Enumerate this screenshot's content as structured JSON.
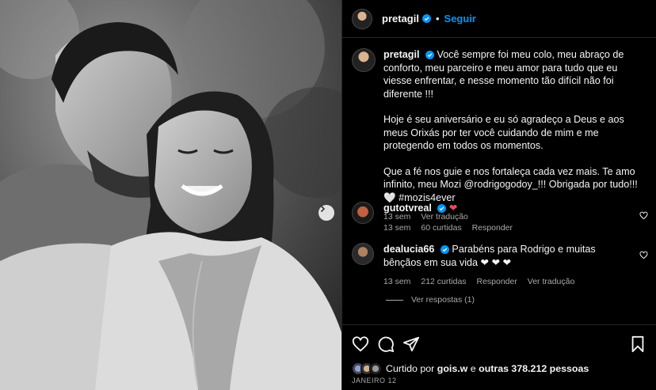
{
  "post": {
    "username": "pretagil",
    "follow_label": "Seguir",
    "separator": "•"
  },
  "caption": {
    "username": "pretagil",
    "paragraphs": [
      "Você sempre foi meu colo, meu abraço de conforto, meu parceiro e meu amor para tudo que eu viesse enfrentar, e nesse momento tão difícil não foi diferente !!!",
      "Hoje é seu aniversário e eu só agradeço a Deus e aos meus Orixás por ter você cuidando de mim e me protegendo em todos os momentos.",
      "Que a fé nos guie e nos fortaleça cada vez mais. Te amo infinito, meu Mozi @rodrigogodoy_!!! Obrigada por tudo!!! 🤍 #mozis4ever"
    ],
    "time": "13 sem",
    "translate": "Ver tradução"
  },
  "comments": [
    {
      "username": "gutotvreal",
      "text": "❤",
      "time": "13 sem",
      "likes": "60 curtidas",
      "reply": "Responder"
    },
    {
      "username": "dealucia66",
      "text": "Parabéns para Rodrigo e muitas bênçãos em sua vida ❤ ❤ ❤",
      "time": "13 sem",
      "likes": "212 curtidas",
      "reply": "Responder",
      "translate": "Ver tradução"
    }
  ],
  "view_replies": "Ver respostas (1)",
  "likes_summary": {
    "prefix": "Curtido por",
    "user": "gois.w",
    "middle": "e",
    "others": "outras 378.212 pessoas"
  },
  "date": "JANEIRO 12",
  "colors": {
    "accent": "#0095f6",
    "heart": "#ed4956",
    "verified": "#0095f6"
  },
  "icons": [
    "heart-icon",
    "comment-icon",
    "share-icon",
    "bookmark-icon",
    "chevron-right-icon",
    "verified-icon"
  ]
}
